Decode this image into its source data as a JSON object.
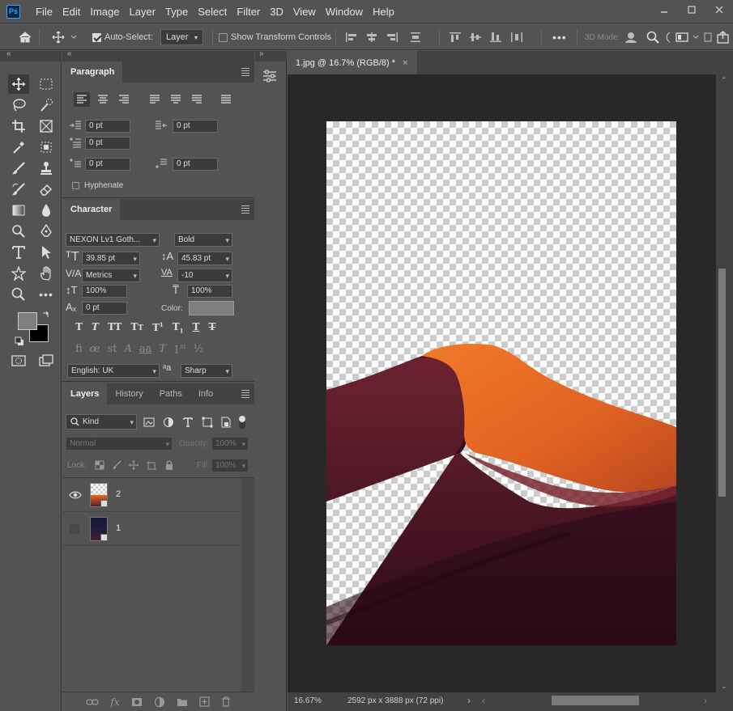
{
  "app": {
    "logo": "Ps",
    "menus": [
      "File",
      "Edit",
      "Image",
      "Layer",
      "Type",
      "Select",
      "Filter",
      "3D",
      "View",
      "Window",
      "Help"
    ]
  },
  "options_bar": {
    "auto_select_label": "Auto-Select:",
    "auto_select_value": "Layer",
    "show_transform_label": "Show Transform Controls",
    "three_d_mode": "3D Mode:"
  },
  "paragraph": {
    "tab": "Paragraph",
    "indent_left": "0 pt",
    "indent_right": "0 pt",
    "indent_first": "0 pt",
    "space_before": "0 pt",
    "space_after": "0 pt",
    "hyphenate": "Hyphenate"
  },
  "character": {
    "tab": "Character",
    "font_family": "NEXON Lv1 Goth...",
    "font_style": "Bold",
    "font_size": "39.85 pt",
    "leading": "45.83 pt",
    "kerning": "Metrics",
    "tracking": "-10",
    "vertical_scale": "100%",
    "horizontal_scale": "100%",
    "baseline_shift": "0 pt",
    "color_label": "Color:",
    "language": "English: UK",
    "antialias": "Sharp",
    "color_swatch": "#7f7f7f"
  },
  "layers_panel": {
    "tabs": [
      "Layers",
      "History",
      "Paths",
      "Info"
    ],
    "filter": "Kind",
    "blend_mode": "Normal",
    "opacity_label": "Opacity:",
    "opacity_value": "100%",
    "lock_label": "Lock:",
    "fill_label": "Fill:",
    "fill_value": "100%",
    "layers": [
      {
        "name": "2",
        "visible": true
      },
      {
        "name": "1",
        "visible": false
      }
    ]
  },
  "document": {
    "tab_title": "1.jpg @ 16.7% (RGB/8) *",
    "zoom": "16.67%",
    "dimensions": "2592 px x 3888 px (72 ppi)"
  },
  "colors": {
    "foreground": "#7f7f7f",
    "background": "#000000",
    "accent": "#31a8ff"
  }
}
